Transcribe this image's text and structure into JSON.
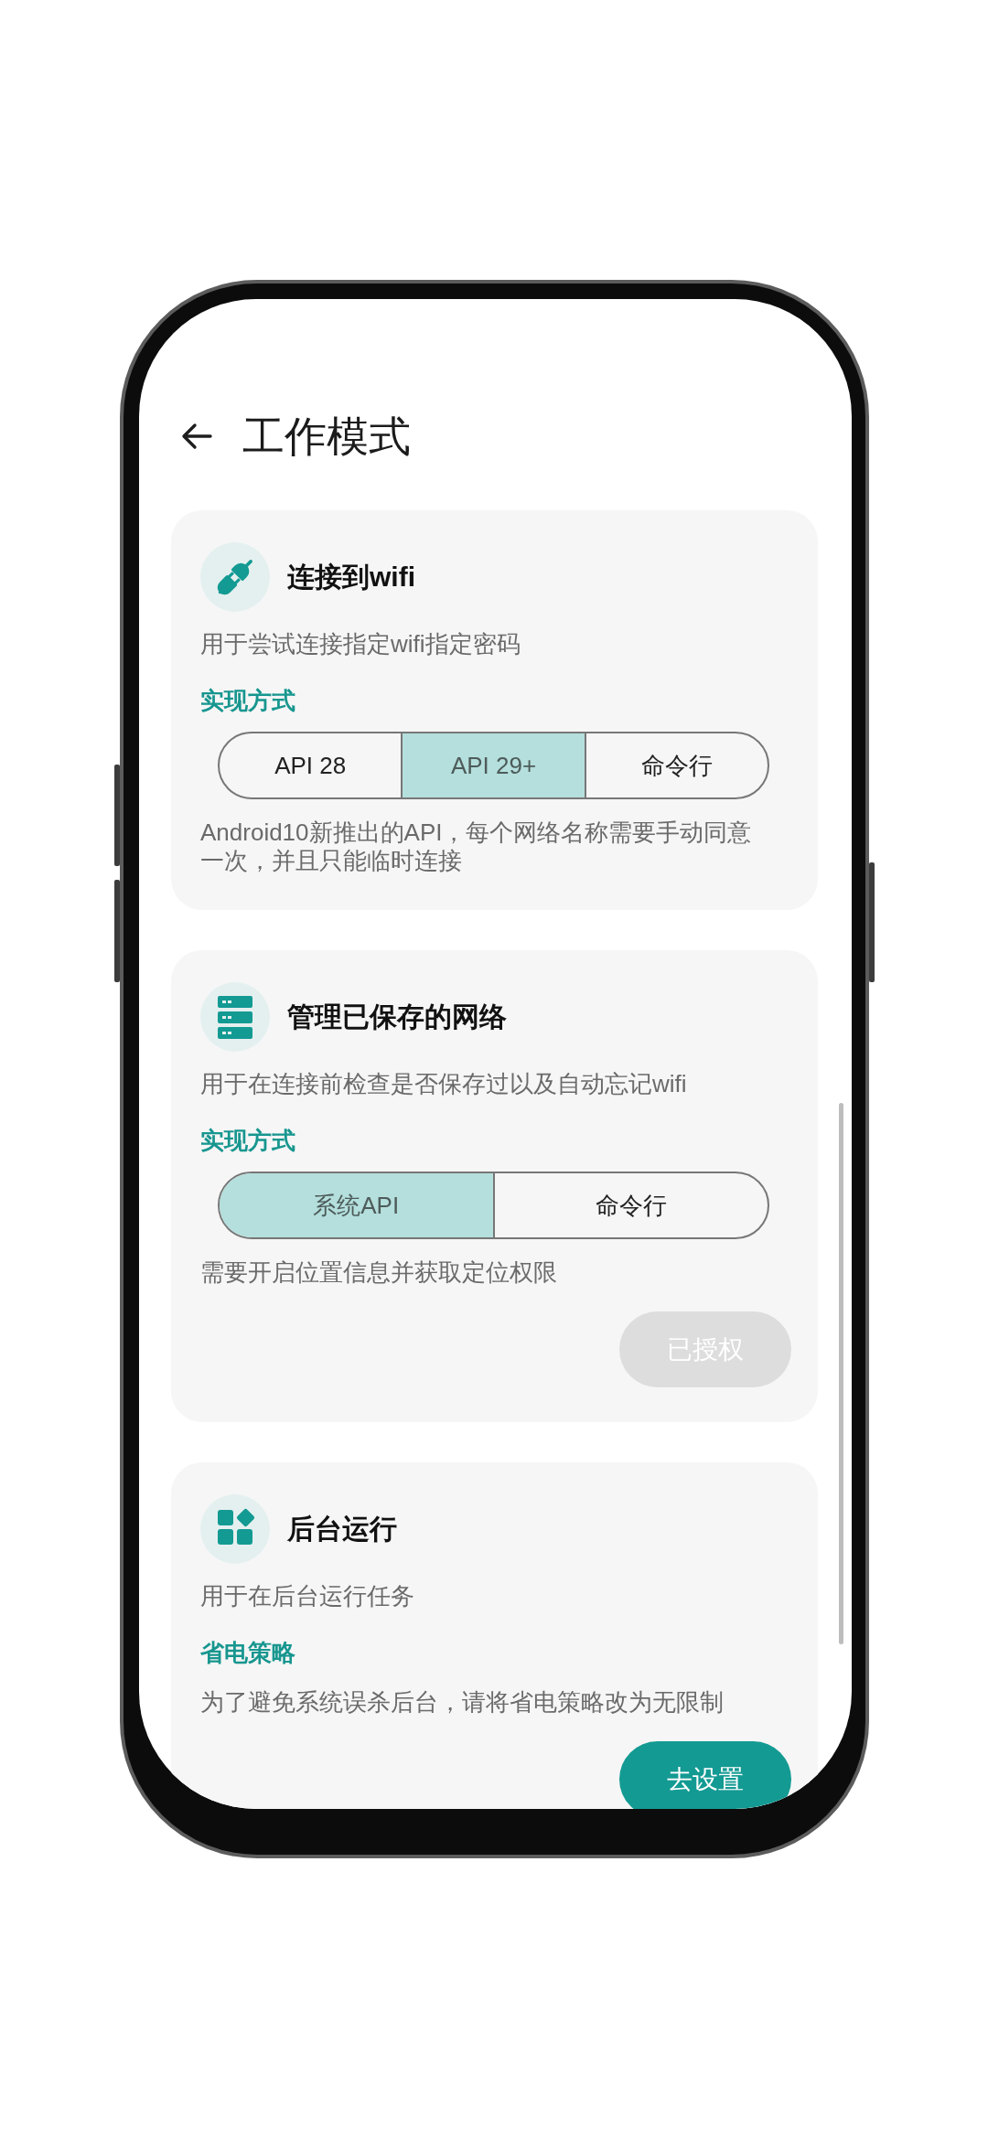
{
  "header": {
    "title": "工作模式"
  },
  "cards": [
    {
      "title": "连接到wifi",
      "description": "用于尝试连接指定wifi指定密码",
      "section_label": "实现方式",
      "options": [
        {
          "label": "API 28",
          "selected": false
        },
        {
          "label": "API 29+",
          "selected": true
        },
        {
          "label": "命令行",
          "selected": false
        }
      ],
      "note": "Android10新推出的API，每个网络名称需要手动同意一次，并且只能临时连接"
    },
    {
      "title": "管理已保存的网络",
      "description": "用于在连接前检查是否保存过以及自动忘记wifi",
      "section_label": "实现方式",
      "options": [
        {
          "label": "系统API",
          "selected": true
        },
        {
          "label": "命令行",
          "selected": false
        }
      ],
      "note": "需要开启位置信息并获取定位权限",
      "button": {
        "label": "已授权",
        "disabled": true
      }
    },
    {
      "title": "后台运行",
      "description": "用于在后台运行任务",
      "section_label": "省电策略",
      "note": "为了避免系统误杀后台，请将省电策略改为无限制",
      "button": {
        "label": "去设置",
        "disabled": false
      }
    }
  ]
}
